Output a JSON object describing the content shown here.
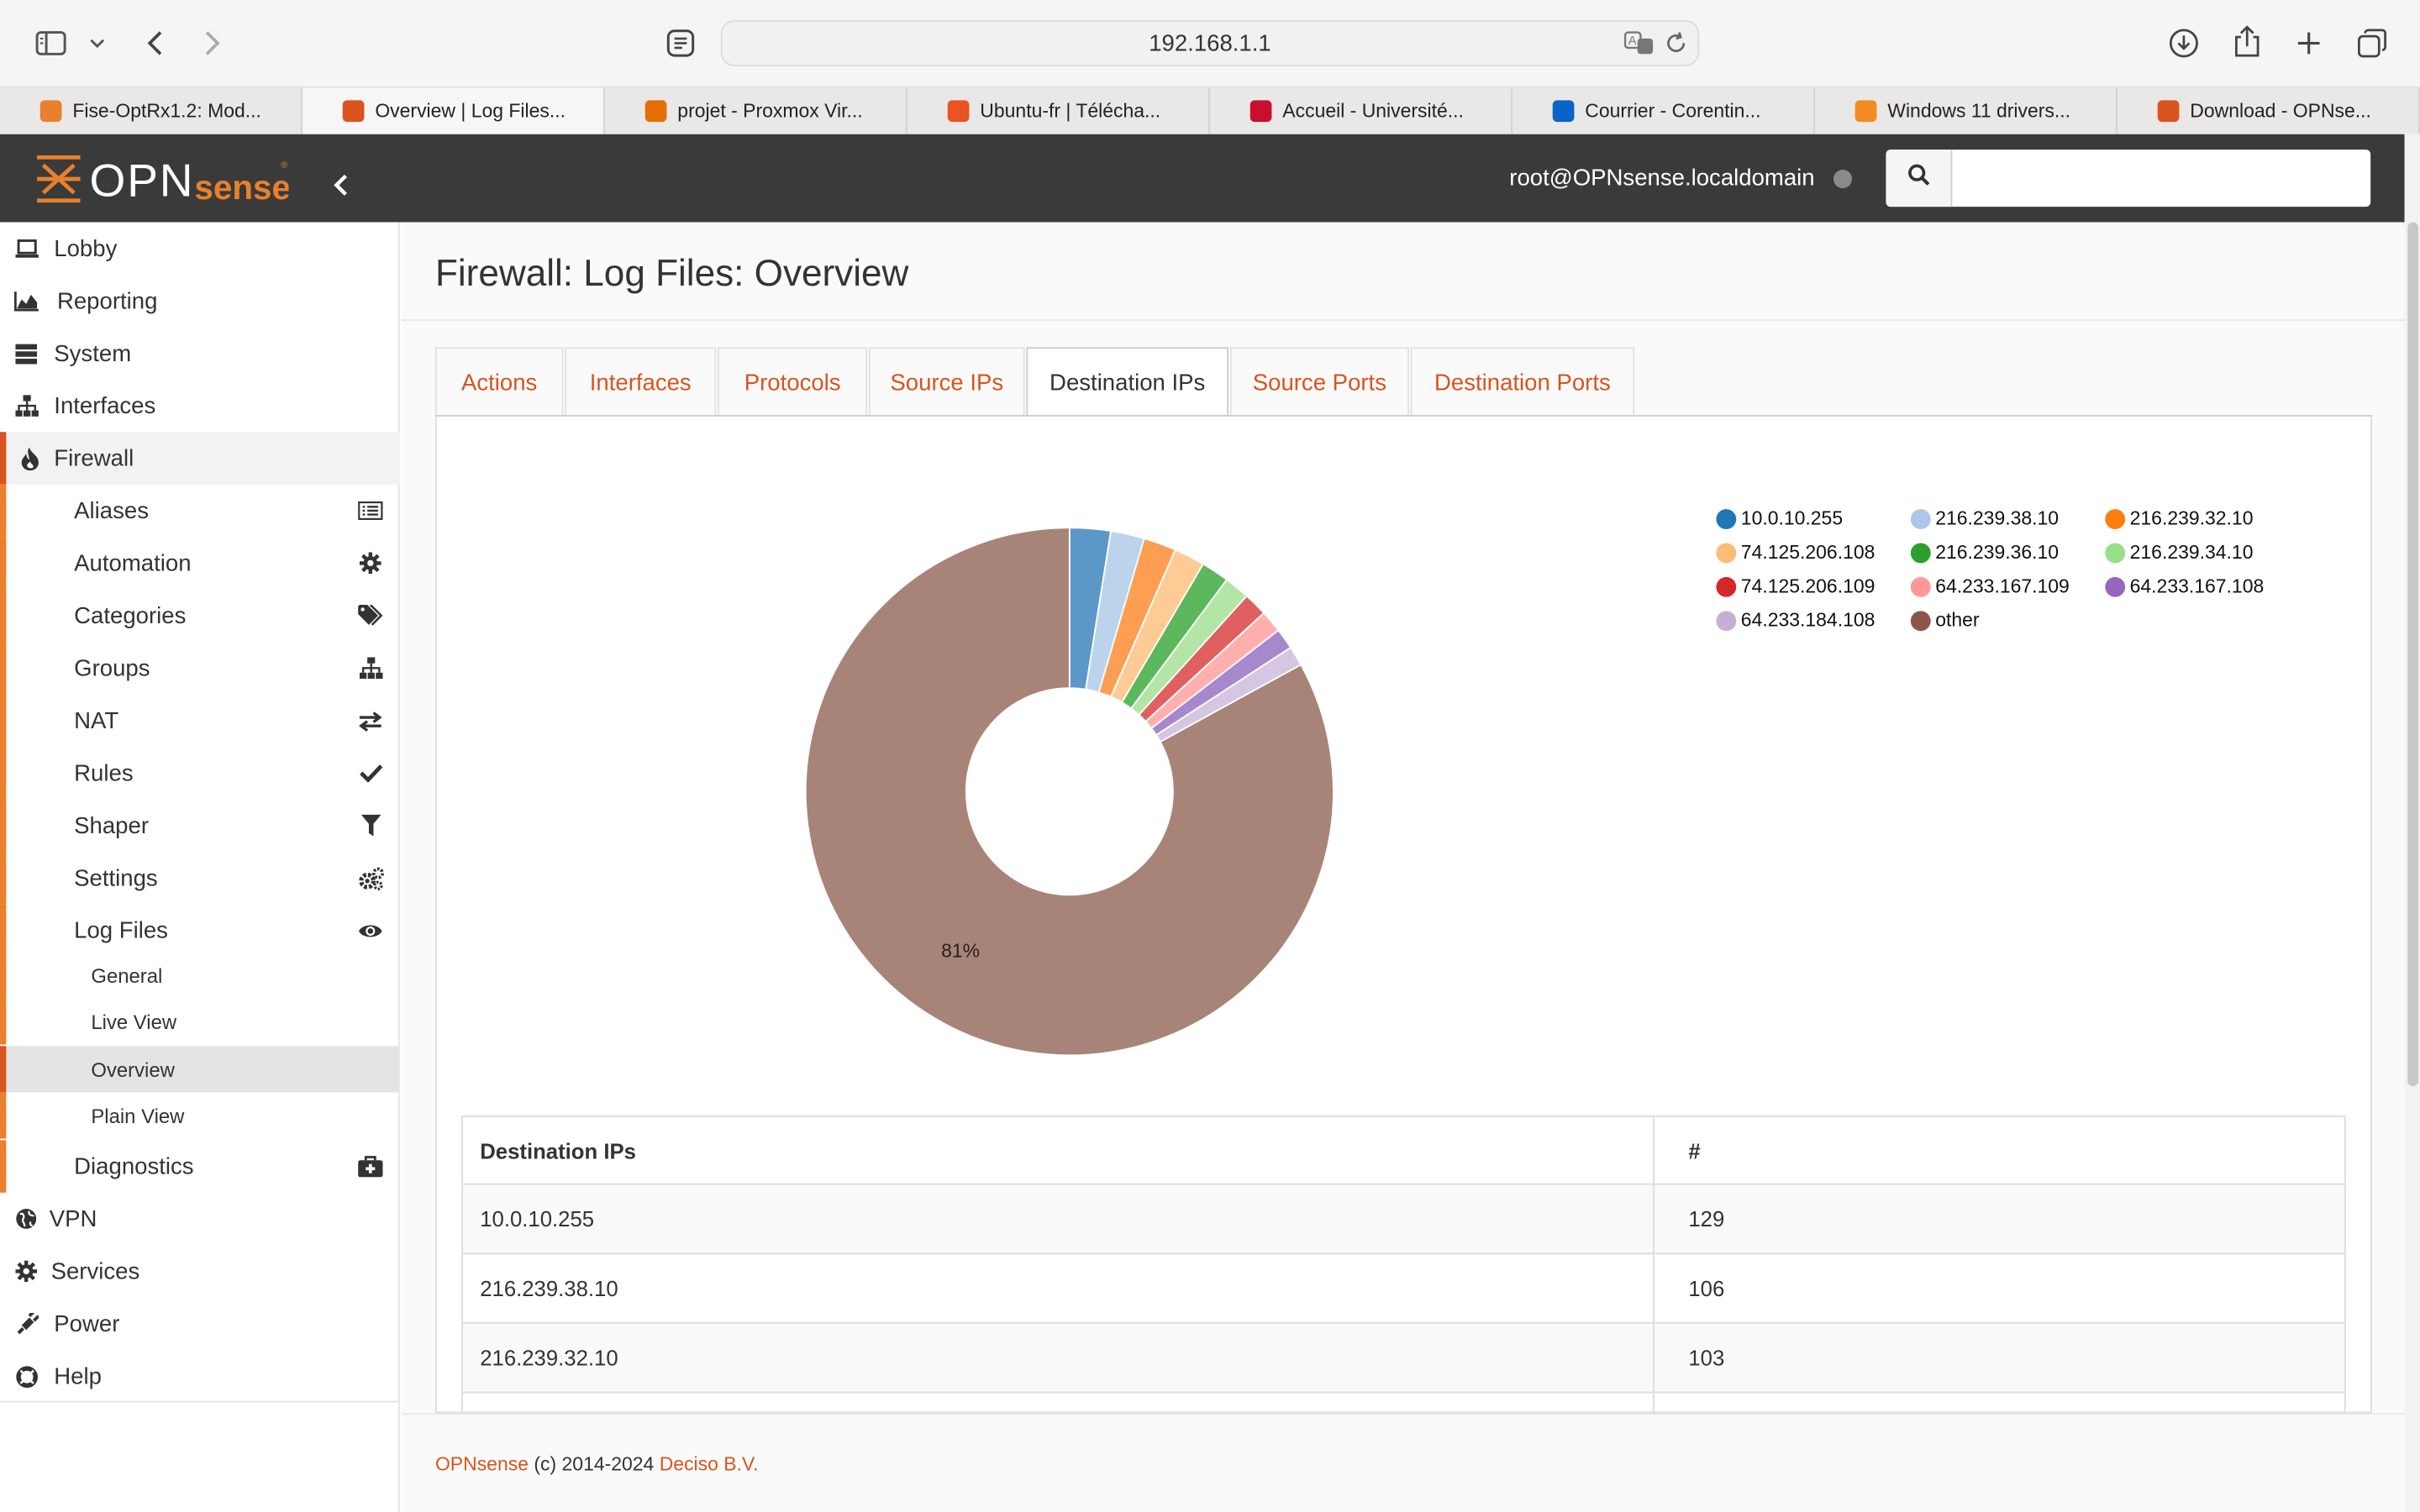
{
  "browser": {
    "url": "192.168.1.1",
    "tabs": [
      {
        "label": "Fise-OptRx1.2: Mod...",
        "favicon_color": "#e8802e"
      },
      {
        "label": "Overview | Log Files...",
        "favicon_color": "#d9541e",
        "active": true
      },
      {
        "label": "projet - Proxmox Vir...",
        "favicon_color": "#e57000"
      },
      {
        "label": "Ubuntu-fr | Télécha...",
        "favicon_color": "#e95420"
      },
      {
        "label": "Accueil - Université...",
        "favicon_color": "#c8102e"
      },
      {
        "label": "Courrier - Corentin...",
        "favicon_color": "#0a64c8"
      },
      {
        "label": "Windows 11 drivers...",
        "favicon_color": "#f28b20"
      },
      {
        "label": "Download - OPNse...",
        "favicon_color": "#d9541e"
      }
    ]
  },
  "header": {
    "logo_text": "OPNsense",
    "user": "root@OPNsense.localdomain",
    "search_placeholder": ""
  },
  "sidebar": {
    "items": [
      {
        "label": "Lobby",
        "icon": "laptop-icon"
      },
      {
        "label": "Reporting",
        "icon": "area-chart-icon"
      },
      {
        "label": "System",
        "icon": "server-icon"
      },
      {
        "label": "Interfaces",
        "icon": "sitemap-icon"
      },
      {
        "label": "Firewall",
        "icon": "fire-icon"
      }
    ],
    "firewall_sub": [
      {
        "label": "Aliases",
        "icon": "list-icon"
      },
      {
        "label": "Automation",
        "icon": "gear-icon"
      },
      {
        "label": "Categories",
        "icon": "tags-icon"
      },
      {
        "label": "Groups",
        "icon": "sitemap-icon"
      },
      {
        "label": "NAT",
        "icon": "exchange-icon"
      },
      {
        "label": "Rules",
        "icon": "check-icon"
      },
      {
        "label": "Shaper",
        "icon": "filter-icon"
      },
      {
        "label": "Settings",
        "icon": "gears-icon"
      },
      {
        "label": "Log Files",
        "icon": "eye-icon"
      }
    ],
    "logfiles_sub": [
      "General",
      "Live View",
      "Overview",
      "Plain View"
    ],
    "after": [
      {
        "label": "Diagnostics",
        "icon": "medkit-icon"
      }
    ],
    "bottom": [
      {
        "label": "VPN",
        "icon": "globe-icon"
      },
      {
        "label": "Services",
        "icon": "cog-icon"
      },
      {
        "label": "Power",
        "icon": "plug-icon"
      },
      {
        "label": "Help",
        "icon": "life-ring-icon"
      }
    ]
  },
  "page": {
    "title": "Firewall: Log Files: Overview",
    "tabs": [
      "Actions",
      "Interfaces",
      "Protocols",
      "Source IPs",
      "Destination IPs",
      "Source Ports",
      "Destination Ports"
    ],
    "active_tab": "Destination IPs"
  },
  "chart_data": {
    "type": "pie",
    "donut": true,
    "slice_label": "81%",
    "categories": [
      "10.0.10.255",
      "216.239.38.10",
      "216.239.32.10",
      "74.125.206.108",
      "216.239.36.10",
      "216.239.34.10",
      "74.125.206.109",
      "64.233.167.109",
      "64.233.167.108",
      "64.233.184.108",
      "other"
    ],
    "values": [
      129,
      106,
      103,
      97,
      88,
      80,
      75,
      70,
      66,
      62,
      4270
    ],
    "colors": [
      "#1f77b4",
      "#aec7e8",
      "#ff7f0e",
      "#ffbb78",
      "#2ca02c",
      "#98df8a",
      "#d62728",
      "#ff9896",
      "#9467bd",
      "#c5b0d5",
      "#8c564b"
    ],
    "slice_colors": [
      "#5b98c8",
      "#bcd3ec",
      "#fd9e53",
      "#fecb95",
      "#5cb85c",
      "#b3e6a5",
      "#e06060",
      "#ffb0ae",
      "#a888cd",
      "#d5c6e2",
      "#a88378"
    ],
    "legend_position": "top-right"
  },
  "table": {
    "headers": [
      "Destination IPs",
      "#"
    ],
    "rows": [
      [
        "10.0.10.255",
        "129"
      ],
      [
        "216.239.38.10",
        "106"
      ],
      [
        "216.239.32.10",
        "103"
      ]
    ]
  },
  "footer": {
    "brand": "OPNsense",
    "copyright": "(c) 2014-2024",
    "company": "Deciso B.V."
  }
}
